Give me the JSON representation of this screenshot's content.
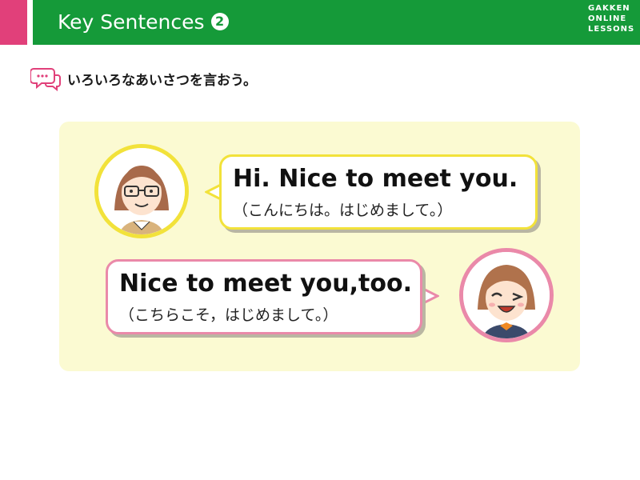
{
  "header": {
    "title": "Key Sentences",
    "number": "2",
    "brand_lines": [
      "GAKKEN",
      "ONLINE",
      "LESSONS"
    ]
  },
  "subtitle": {
    "icon": "speech-bubbles-icon",
    "text": "いろいろなあいさつを言おう。"
  },
  "dialogue": [
    {
      "speaker": "teacher",
      "english": "Hi.  Nice to meet you.",
      "japanese": "（こんにちは。はじめまして。）"
    },
    {
      "speaker": "student",
      "english": "Nice to meet you,too.",
      "japanese": "（こちらこそ，はじめまして。）"
    }
  ],
  "colors": {
    "header_green": "#159a39",
    "accent_pink": "#e1407a",
    "panel_yellow": "#fbfad2",
    "bubble_yellow_border": "#f2e23a",
    "bubble_pink_border": "#ea89a9"
  }
}
